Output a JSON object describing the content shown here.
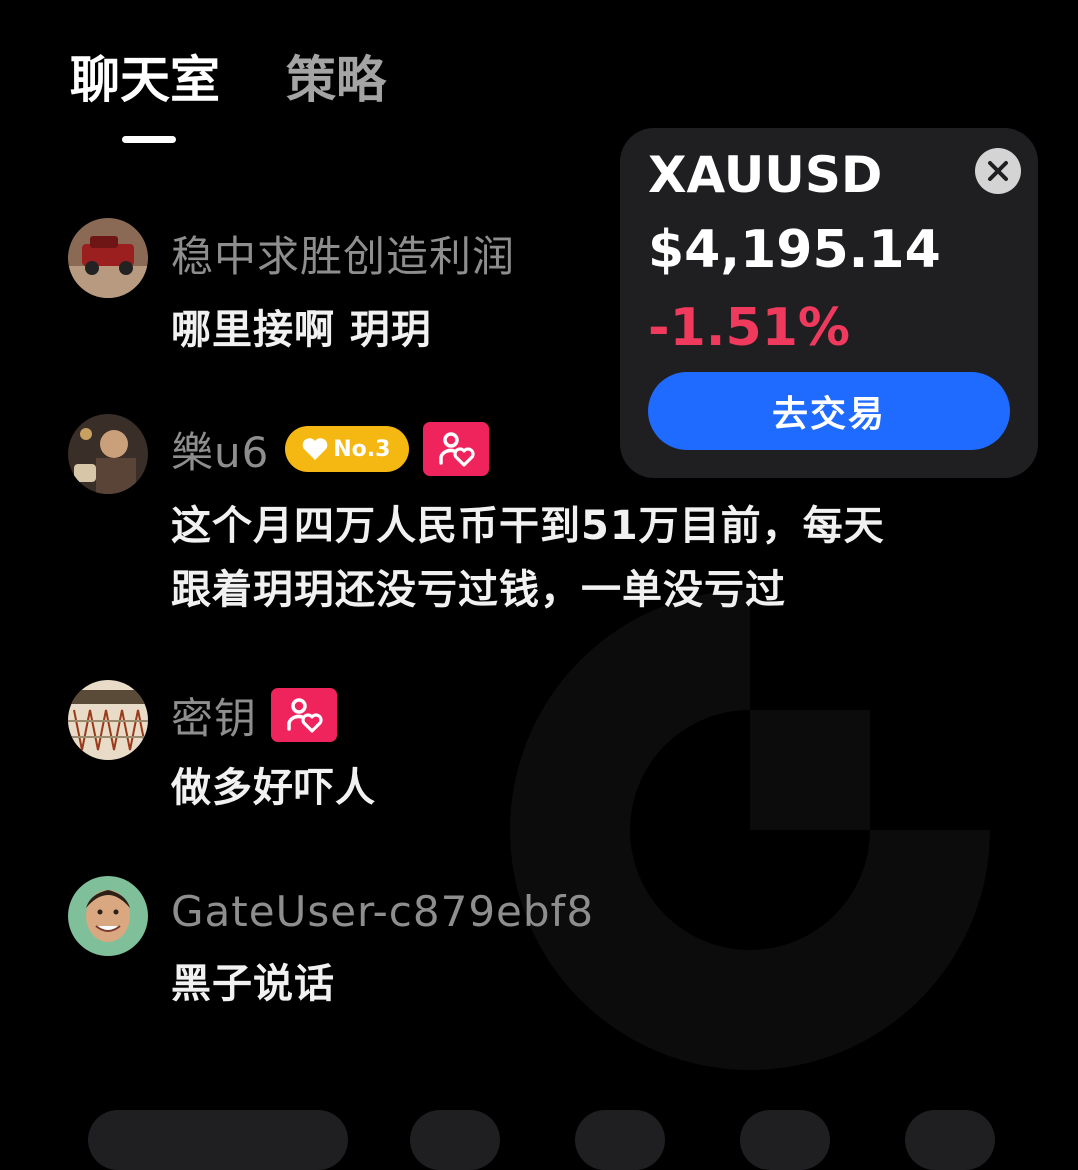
{
  "tabs": {
    "chat": "聊天室",
    "strategy": "策略"
  },
  "messages": [
    {
      "username": "稳中求胜创造利润",
      "text": "哪里接啊 玥玥"
    },
    {
      "username": "樂u6",
      "badge_rank": "No.3",
      "text_line1": "这个月四万人民币干到51万目前，每天",
      "text_line2": "跟着玥玥还没亏过钱，一单没亏过"
    },
    {
      "username": "密钥",
      "text": "做多好吓人"
    },
    {
      "username": "GateUser-c879ebf8",
      "text": "黑子说话"
    }
  ],
  "price_card": {
    "symbol": "XAUUSD",
    "price": "$4,195.14",
    "change": "-1.51%",
    "trade_button": "去交易"
  },
  "colors": {
    "background": "#000000",
    "negative": "#ef3a5d",
    "accent_blue": "#1f6bff",
    "rank_badge": "#f5b812",
    "follow_badge": "#f0245c"
  }
}
